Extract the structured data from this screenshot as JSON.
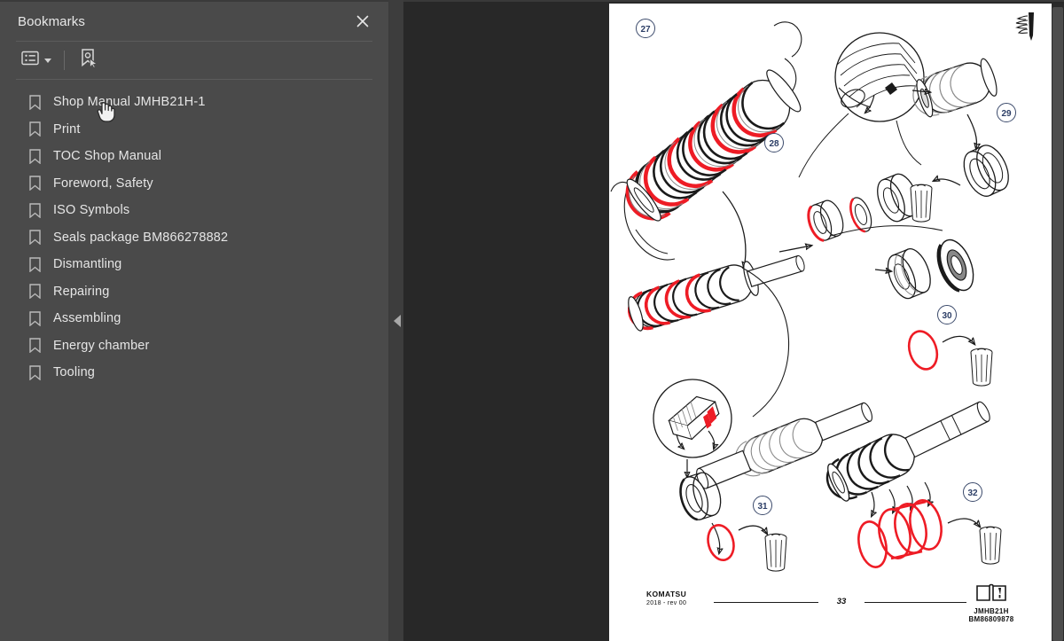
{
  "panel": {
    "title": "Bookmarks",
    "close_icon": "close-icon",
    "toolbar": {
      "options_label": "Bookmark options",
      "options_icon": "list-options-icon",
      "dropdown_icon": "chevron-down-icon",
      "new_bookmark_label": "New bookmark",
      "new_bookmark_icon": "new-bookmark-icon"
    },
    "items": [
      {
        "label": "Shop Manual JMHB21H-1",
        "icon": "bookmark-icon"
      },
      {
        "label": "Print",
        "icon": "bookmark-icon"
      },
      {
        "label": "TOC Shop Manual",
        "icon": "bookmark-icon"
      },
      {
        "label": "Foreword, Safety",
        "icon": "bookmark-icon"
      },
      {
        "label": "ISO Symbols",
        "icon": "bookmark-icon"
      },
      {
        "label": "Seals package BM866278882",
        "icon": "bookmark-icon"
      },
      {
        "label": "Dismantling",
        "icon": "bookmark-icon"
      },
      {
        "label": "Repairing",
        "icon": "bookmark-icon"
      },
      {
        "label": "Assembling",
        "icon": "bookmark-icon"
      },
      {
        "label": "Energy chamber",
        "icon": "bookmark-icon"
      },
      {
        "label": "Tooling",
        "icon": "bookmark-icon"
      }
    ]
  },
  "collapse": {
    "icon": "collapse-left-icon"
  },
  "viewer": {
    "page": {
      "corner_icon": "hand-chisel-icon",
      "footer": {
        "brand": "KOMATSU",
        "revision": "2018 -  rev 00",
        "page_number": "33",
        "doc_icon": "manual-book-icon",
        "model": "JMHB21H",
        "code": "BM86809878"
      },
      "callouts": [
        "27",
        "28",
        "29",
        "30",
        "31",
        "32"
      ]
    },
    "scrollbar": {
      "name": "vertical-scrollbar"
    }
  },
  "colors": {
    "panel_bg": "#4a4a4a",
    "viewer_bg": "#282828",
    "page_bg": "#ffffff",
    "accent_red": "#ee1c25",
    "callout_blue": "#2c3e66",
    "text_light": "#e6e6e6"
  }
}
